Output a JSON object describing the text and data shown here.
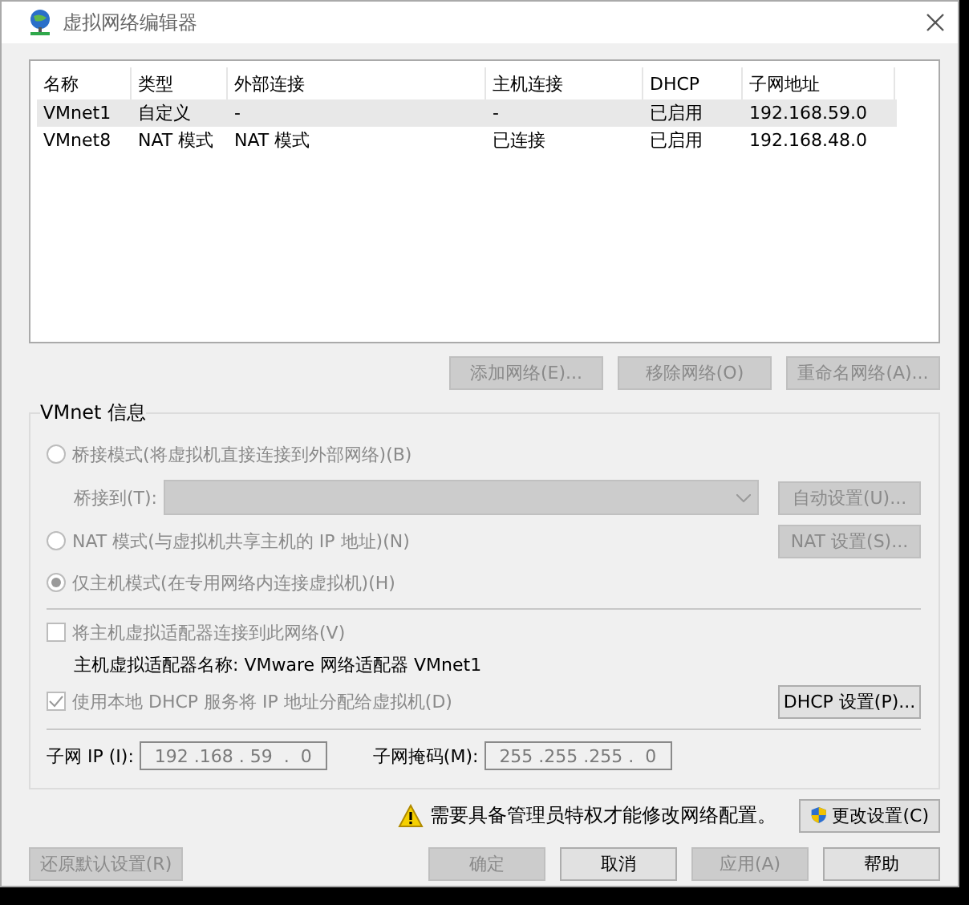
{
  "window": {
    "title": "虚拟网络编辑器"
  },
  "table": {
    "columns": [
      "名称",
      "类型",
      "外部连接",
      "主机连接",
      "DHCP",
      "子网地址"
    ],
    "rows": [
      {
        "cells": [
          "VMnet1",
          "自定义",
          "-",
          "-",
          "已启用",
          "192.168.59.0"
        ],
        "selected": true
      },
      {
        "cells": [
          "VMnet8",
          "NAT 模式",
          "NAT 模式",
          "已连接",
          "已启用",
          "192.168.48.0"
        ],
        "selected": false
      }
    ]
  },
  "table_buttons": [
    {
      "label": "添加网络(E)...",
      "disabled": true
    },
    {
      "label": "移除网络(O)",
      "disabled": true
    },
    {
      "label": "重命名网络(A)...",
      "disabled": true
    }
  ],
  "vmnet_info": {
    "title": "VMnet 信息",
    "bridged": {
      "label": "桥接模式(将虚拟机直接连接到外部网络)(B)",
      "selected": false,
      "bridge_to_label": "桥接到(T):",
      "button": "自动设置(U)..."
    },
    "nat": {
      "label": "NAT 模式(与虚拟机共享主机的 IP 地址)(N)",
      "selected": false,
      "button": "NAT 设置(S)..."
    },
    "host_only": {
      "label": "仅主机模式(在专用网络内连接虚拟机)(H)",
      "selected": true
    },
    "connect_adapter": {
      "label": "将主机虚拟适配器连接到此网络(V)",
      "checked": false
    },
    "adapter_name": "主机虚拟适配器名称: VMware 网络适配器 VMnet1",
    "use_dhcp": {
      "label": "使用本地 DHCP 服务将 IP 地址分配给虚拟机(D)",
      "checked": true
    },
    "dhcp_button": "DHCP 设置(P)...",
    "subnet_ip": {
      "label": "子网 IP (I):",
      "value": "192 .168 . 59  .  0"
    },
    "subnet_mask": {
      "label": "子网掩码(M):",
      "value": "255 .255 .255 .  0"
    }
  },
  "admin_notice": "需要具备管理员特权才能修改网络配置。",
  "change_settings_button": "更改设置(C)",
  "restore_button": {
    "label": "还原默认设置(R)",
    "disabled": true
  },
  "dialog_buttons": [
    {
      "label": "确定",
      "disabled": true
    },
    {
      "label": "取消",
      "disabled": false
    },
    {
      "label": "应用(A)",
      "disabled": true
    },
    {
      "label": "帮助",
      "disabled": false
    }
  ]
}
